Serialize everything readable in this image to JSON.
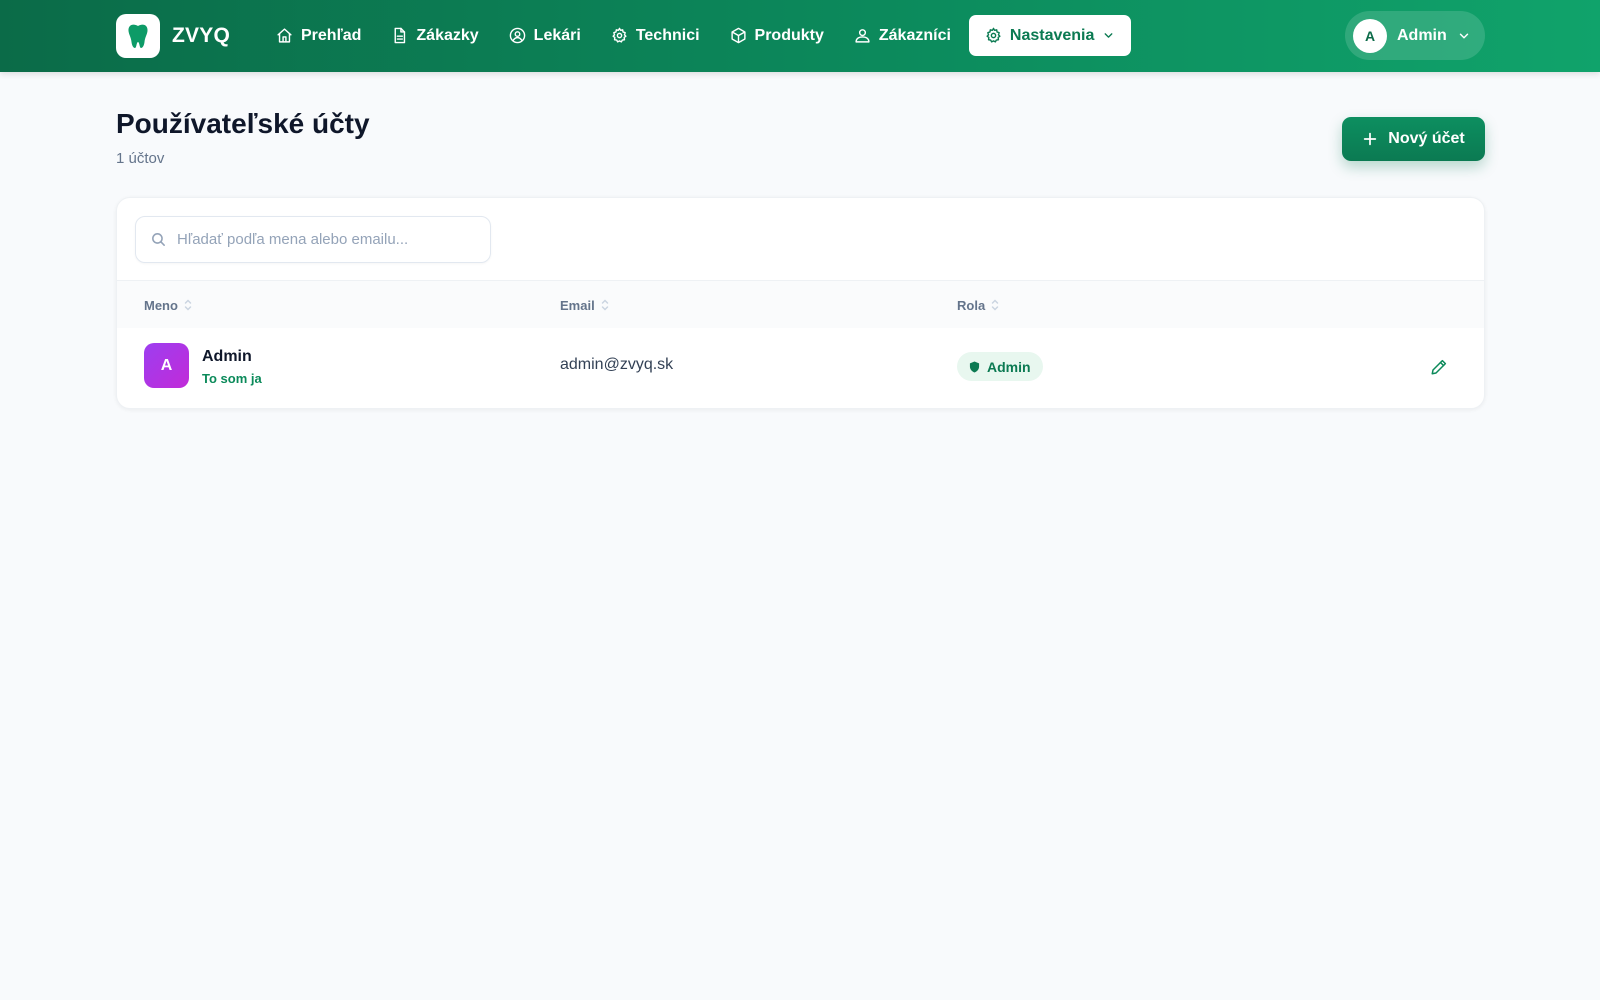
{
  "app": {
    "name": "ZVYQ"
  },
  "nav": {
    "items": [
      {
        "label": "Prehľad",
        "icon": "home-icon"
      },
      {
        "label": "Zákazky",
        "icon": "document-icon"
      },
      {
        "label": "Lekári",
        "icon": "user-circle-icon"
      },
      {
        "label": "Technici",
        "icon": "gear-icon"
      },
      {
        "label": "Produkty",
        "icon": "box-icon"
      },
      {
        "label": "Zákazníci",
        "icon": "users-icon"
      },
      {
        "label": "Nastavenia",
        "icon": "gear-icon",
        "active": true
      }
    ]
  },
  "user": {
    "initial": "A",
    "name": "Admin"
  },
  "page": {
    "title": "Používateľské účty",
    "subtitle": "1 účtov",
    "new_button": "Nový účet"
  },
  "search": {
    "placeholder": "Hľadať podľa mena alebo emailu...",
    "value": ""
  },
  "table": {
    "columns": [
      "Meno",
      "Email",
      "Rola"
    ],
    "rows": [
      {
        "initial": "A",
        "name": "Admin",
        "self_label": "To som ja",
        "email": "admin@zvyq.sk",
        "role": "Admin"
      }
    ]
  },
  "colors": {
    "primary": "#0b7a52",
    "accent_gradient_start": "#0b6b48",
    "accent_gradient_end": "#10a36b",
    "avatar_purple": "#9d3ef0"
  }
}
